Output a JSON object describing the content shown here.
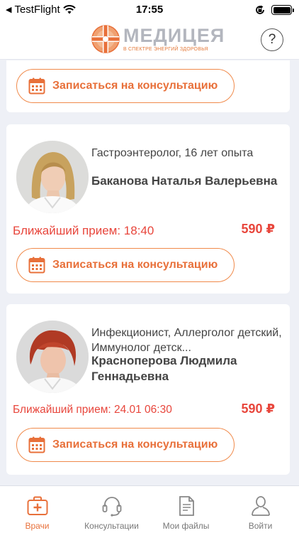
{
  "status_bar": {
    "carrier": "TestFlight",
    "time": "17:55"
  },
  "header": {
    "logo_name": "МЕДИЦЕЯ",
    "logo_tagline": "В СПЕКТРЕ ЭНЕРГИЙ ЗДОРОВЬЯ",
    "help_label": "?"
  },
  "book_label": "Записаться на консультацию",
  "doctors": [
    {
      "specialty": "Гастроэнтеролог, 16 лет опыта",
      "name": "Баканова Наталья Валерьевна",
      "nearest": "Ближайший прием: 18:40",
      "price": "590 ₽",
      "photo": "doctor-photo-blonde"
    },
    {
      "specialty": "Инфекционист, Аллерголог детский, Иммунолог детск...",
      "name": "Красноперова Людмила Геннадьевна",
      "nearest": "Ближайший прием: 24.01 06:30",
      "price": "590 ₽",
      "photo": "doctor-photo-redhead"
    }
  ],
  "tabs": [
    {
      "label": "Врачи",
      "icon": "medical-kit-icon",
      "active": true
    },
    {
      "label": "Консультации",
      "icon": "headset-icon",
      "active": false
    },
    {
      "label": "Мои файлы",
      "icon": "document-icon",
      "active": false
    },
    {
      "label": "Войти",
      "icon": "person-icon",
      "active": false
    }
  ],
  "colors": {
    "accent": "#e8703a",
    "price": "#e8463c",
    "background": "#eef0f6"
  }
}
